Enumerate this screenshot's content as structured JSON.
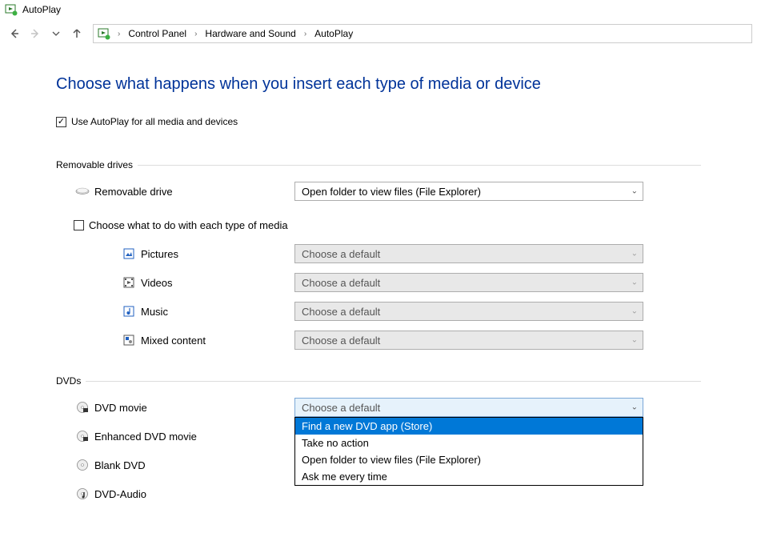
{
  "window": {
    "title": "AutoPlay"
  },
  "breadcrumb": {
    "cp": "Control Panel",
    "hw": "Hardware and Sound",
    "ap": "AutoPlay"
  },
  "page": {
    "heading": "Choose what happens when you insert each type of media or device",
    "master_checkbox_label": "Use AutoPlay for all media and devices"
  },
  "sections": {
    "removable": {
      "title": "Removable drives",
      "drive_label": "Removable drive",
      "drive_value": "Open folder to view files (File Explorer)",
      "each_type_label": "Choose what to do with each type of media",
      "pictures": {
        "label": "Pictures",
        "value": "Choose a default"
      },
      "videos": {
        "label": "Videos",
        "value": "Choose a default"
      },
      "music": {
        "label": "Music",
        "value": "Choose a default"
      },
      "mixed": {
        "label": "Mixed content",
        "value": "Choose a default"
      }
    },
    "dvds": {
      "title": "DVDs",
      "dvd_movie": {
        "label": "DVD movie",
        "value": "Choose a default"
      },
      "enhanced": {
        "label": "Enhanced DVD movie"
      },
      "blank": {
        "label": "Blank DVD"
      },
      "audio": {
        "label": "DVD-Audio"
      },
      "options": {
        "opt1": "Find a new DVD app (Store)",
        "opt2": "Take no action",
        "opt3": "Open folder to view files (File Explorer)",
        "opt4": "Ask me every time"
      }
    }
  }
}
